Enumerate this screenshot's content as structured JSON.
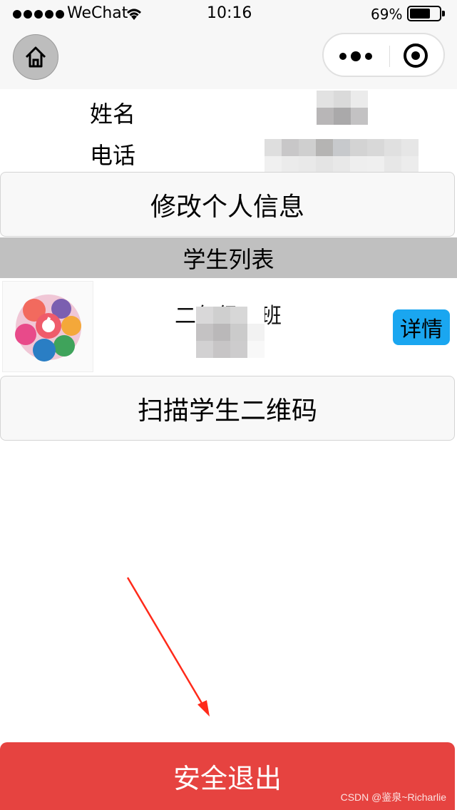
{
  "status_bar": {
    "carrier": "WeChat",
    "time": "10:16",
    "battery_percent": "69%",
    "battery_level": 0.69
  },
  "nav": {
    "home_icon": "home-icon",
    "more_icon": "more-dots-icon",
    "close_icon": "target-circle-icon"
  },
  "profile": {
    "name_label": "姓名",
    "phone_label": "电话"
  },
  "buttons": {
    "edit_profile": "修改个人信息",
    "scan_qr": "扫描学生二维码",
    "logout": "安全退出"
  },
  "student_list": {
    "title": "学生列表",
    "items": [
      {
        "class_name": "二年级一班",
        "detail_label": "详情"
      }
    ]
  },
  "watermark": "CSDN @鉴泉~Richarlie",
  "colors": {
    "logout_bg": "#e64340",
    "detail_bg": "#1aa6f0",
    "section_bg": "#c0c0c0",
    "arrow": "#ff2a1a"
  }
}
